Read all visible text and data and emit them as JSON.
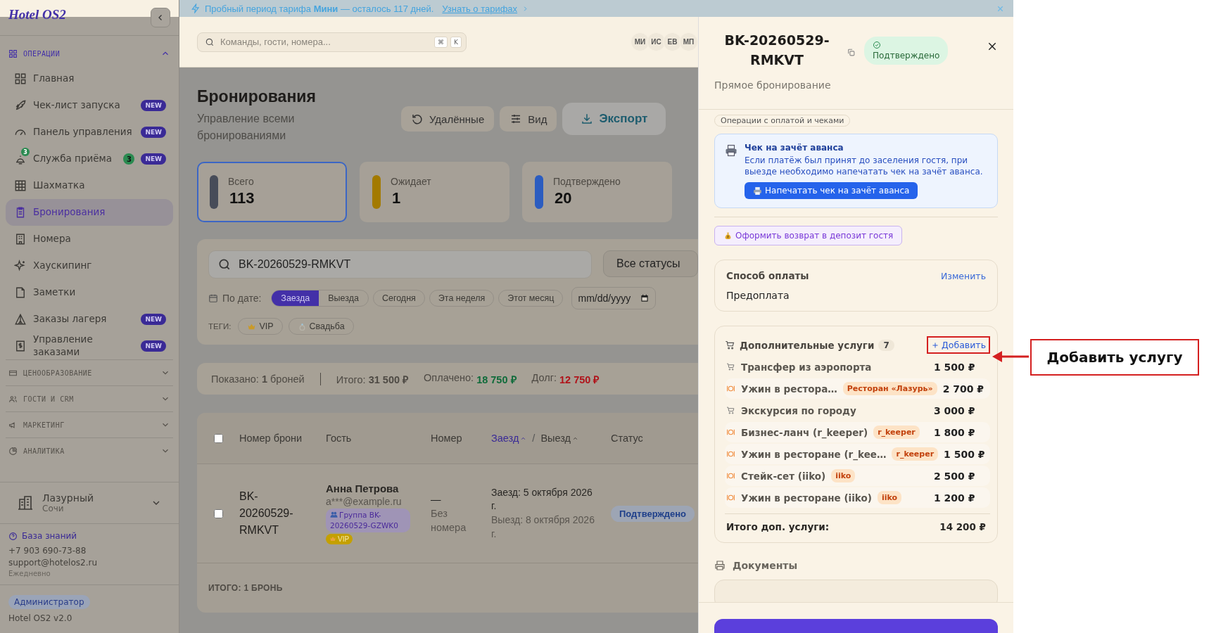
{
  "banner": {
    "message": "Пробный период тарифа **Мини** — осталось 117 дней.",
    "link": "Узнать о тарифах"
  },
  "sidebar": {
    "logo": "Hotel OS2",
    "sections": [
      {
        "title": "ОПЕРАЦИИ",
        "expanded": true,
        "items": [
          {
            "label": "Главная",
            "selected": false
          },
          {
            "label": "Чек-лист запуска",
            "selected": false,
            "badge": "NEW"
          },
          {
            "label": "Панель управления",
            "selected": false,
            "badge": "NEW"
          },
          {
            "label": "Служба приёма",
            "selected": false,
            "badge": "NEW",
            "icon_count": "3",
            "count": "3"
          },
          {
            "label": "Шахматка",
            "selected": false
          },
          {
            "label": "Бронирования",
            "selected": true
          },
          {
            "label": "Номера",
            "selected": false
          },
          {
            "label": "Хаускипинг",
            "selected": false
          },
          {
            "label": "Заметки",
            "selected": false
          },
          {
            "label": "Заказы лагеря",
            "selected": false,
            "badge": "NEW"
          },
          {
            "label": "Управление заказами",
            "selected": false,
            "badge": "NEW"
          }
        ]
      },
      {
        "title": "ЦЕНООБРАЗОВАНИЕ",
        "expanded": false
      },
      {
        "title": "ГОСТИ И CRM",
        "expanded": false
      },
      {
        "title": "МАРКЕТИНГ",
        "expanded": false
      },
      {
        "title": "АНАЛИТИКА",
        "expanded": false
      }
    ],
    "property": {
      "name": "Лазурный",
      "city": "Сочи"
    },
    "help_link": "База знаний",
    "phone": "+7 903 690-73-88",
    "email": "support@hotelos2.ru",
    "hours": "Ежедневно",
    "role": "Администратор",
    "version": "Hotel OS2 v2.0"
  },
  "topbar": {
    "search_placeholder": "Команды, гости, номера...",
    "shortcut_keys": [
      "⌘",
      "K"
    ],
    "avatars": [
      "МИ",
      "ИС",
      "ЕВ",
      "МП"
    ]
  },
  "page": {
    "title": "Бронирования",
    "subtitle": "Управление всеми бронированиями",
    "actions": [
      {
        "label": "Удалённые",
        "kind": "restore"
      },
      {
        "label": "Вид",
        "kind": "view"
      },
      {
        "label": "Экспорт",
        "kind": "export"
      }
    ]
  },
  "stats": [
    {
      "label": "Всего",
      "value": "113",
      "color": "#474c59",
      "selected": true
    },
    {
      "label": "Ожидает",
      "value": "1",
      "color": "#a37a00",
      "selected": false
    },
    {
      "label": "Подтверждено",
      "value": "20",
      "color": "#2b5cc0",
      "selected": false
    }
  ],
  "filters": {
    "search_value": "BK-20260529-RMKVT",
    "status_select": "Все статусы",
    "date_label": "По дате:",
    "date_modes": [
      {
        "label": "Заезда",
        "selected": true
      },
      {
        "label": "Выезда",
        "selected": false
      }
    ],
    "presets": [
      "Сегодня",
      "Эта неделя",
      "Этот месяц"
    ],
    "date_placeholder": "mm/dd/yyyy",
    "tags_label": "ТЕГИ:",
    "tags": [
      {
        "label": "VIP",
        "kind": "crown"
      },
      {
        "label": "Свадьба",
        "kind": "ring"
      }
    ]
  },
  "summary": {
    "shown": "Показано: **1** броней",
    "total": "Итого: **31 500 ₽**",
    "paid_label": "Оплачено:",
    "paid": "18 750 ₽",
    "debt_label": "Долг:",
    "debt": "12 750 ₽"
  },
  "table": {
    "all_checked": false,
    "columns": [
      {
        "kind": "text",
        "label": "Номер брони"
      },
      {
        "kind": "text",
        "label": "Гость"
      },
      {
        "kind": "text",
        "label": "Номер"
      },
      {
        "kind": "sort",
        "separator": "/",
        "keys": [
          {
            "label": "Заезд",
            "selected": true
          },
          {
            "label": "Выезд",
            "selected": false
          }
        ]
      },
      {
        "kind": "text",
        "label": "Статус"
      }
    ],
    "rows": [
      {
        "checked": false,
        "booking_no": "BK-20260529-RMKVT",
        "guest_name": "Анна Петрова",
        "guest_email": "a***@example.ru",
        "group": "Группа BK-20260529-GZWK0",
        "tag": "VIP",
        "room": "—",
        "room_note": "Без номера",
        "checkin": "Заезд: 5 октября 2026 г.",
        "checkout": "Выезд: 8 октября 2026 г.",
        "status": "Подтверждено"
      }
    ],
    "footer": "ИТОГО: 1 БРОНЬ"
  },
  "drawer": {
    "title": "BK-20260529-RMKVT",
    "status": "Подтверждено",
    "subtitle": "Прямое бронирование",
    "section_pill": "Операции с оплатой и чеками",
    "receipt": {
      "title": "Чек на зачёт аванса",
      "text": "Если платёж был принят до заселения гостя, при выезде необходимо напечатать чек на зачёт аванса.",
      "button": "Напечатать чек на зачёт аванса"
    },
    "refund_button": "Оформить возврат в депозит гостя",
    "payment": {
      "title": "Способ оплаты",
      "action": "Изменить",
      "value": "Предоплата"
    },
    "services": {
      "title": "Дополнительные услуги",
      "count": "7",
      "add": "Добавить",
      "items": [
        {
          "kind": "service",
          "name": "Трансфер из аэропорта",
          "price": "1 500 ₽"
        },
        {
          "kind": "restaurant",
          "name": "Ужин в рестора…",
          "tag": "Ресторан «Лазурь»",
          "price": "2 700 ₽"
        },
        {
          "kind": "service",
          "name": "Экскурсия по городу",
          "price": "3 000 ₽"
        },
        {
          "kind": "restaurant",
          "name": "Бизнес-ланч (r_keeper)",
          "tag": "r_keeper",
          "price": "1 800 ₽"
        },
        {
          "kind": "restaurant",
          "name": "Ужин в ресторане (r_kee…",
          "tag": "r_keeper",
          "price": "1 500 ₽"
        },
        {
          "kind": "restaurant",
          "name": "Стейк-сет (iiko)",
          "tag": "iiko",
          "price": "2 500 ₽"
        },
        {
          "kind": "restaurant",
          "name": "Ужин в ресторане (iiko)",
          "tag": "iiko",
          "price": "1 200 ₽"
        }
      ],
      "total_label": "Итого доп. услуги:",
      "total": "14 200 ₽"
    },
    "documents_title": "Документы"
  },
  "annotation": {
    "label": "Добавить услугу"
  }
}
